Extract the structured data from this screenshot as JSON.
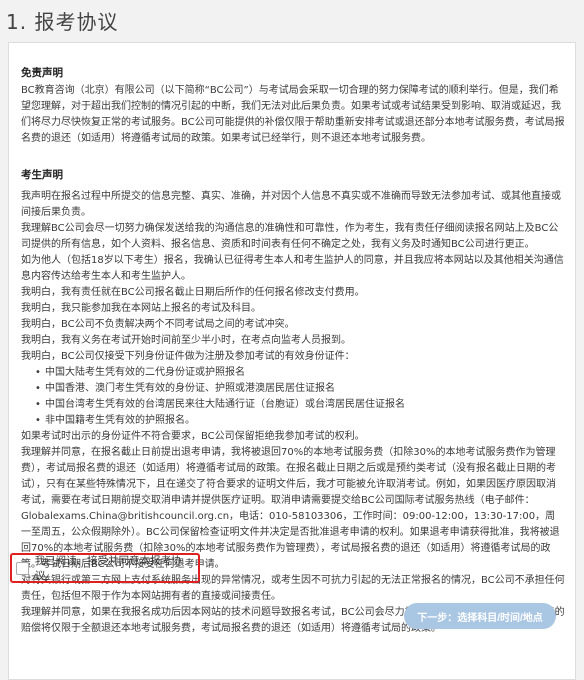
{
  "page": {
    "title": "1. 报考协议"
  },
  "disclaimer": {
    "title": "免责声明",
    "lines": [
      "BC教育咨询（北京）有限公司（以下简称“BC公司”）与考试局会采取一切合理的努力保障考试的顺利举行。但是，我们希望您理解，对于超出我们控制的情况引起的中断，我们无法对此后果负责。如果考试或考试结果受到影响、取消或延迟，我们将尽力尽快恢复正常的考试服务。BC公司可能提供的补偿仅限于帮助重新安排考试或退还部分本地考试服务费，考试局报名费的退还（如适用）将遵循考试局的政策。如果考试已经举行，则不退还本地考试服务费。"
    ]
  },
  "declaration": {
    "title": "考生声明",
    "lines": [
      "我声明在报名过程中所提交的信息完整、真实、准确，并对因个人信息不真实或不准确而导致无法参加考试、或其他直接或间接后果负责。",
      "我理解BC公司会尽一切努力确保发送给我的沟通信息的准确性和可靠性，作为考生，我有责任仔细阅读报名网站上及BC公司提供的所有信息，如个人资料、报名信息、资质和时间表有任何不确定之处，我有义务及时通知BC公司进行更正。",
      "如为他人（包括18岁以下考生）报名，我确认已征得考生本人和考生监护人的同意，并且我应将本网站以及其他相关沟通信息内容传达给考生本人和考生监护人。",
      "我明白，我有责任就在BC公司报名截止日期后所作的任何报名修改支付费用。",
      "我明白，我只能参加我在本网站上报名的考试及科目。",
      "我明白，BC公司不负责解决两个不同考试局之间的考试冲突。",
      "我明白，我有义务在考试开始时间前至少半小时，在考点向监考人员报到。",
      "我明白，BC公司仅接受下列身份证件做为注册及参加考试的有效身份证件："
    ],
    "bullets": [
      "中国大陆考生凭有效的二代身份证或护照报名",
      "中国香港、澳门考生凭有效的身份证、护照或港澳居民居住证报名",
      "中国台湾考生凭有效的台湾居民来往大陆通行证（台胞证）或台湾居民居住证报名",
      "非中国籍考生凭有效的护照报名。"
    ],
    "tail_lines": [
      "如果考试时出示的身份证件不符合要求，BC公司保留拒绝我参加考试的权利。",
      "我理解并同意，在报名截止日前提出退考申请，我将被退回70%的本地考试服务费（扣除30%的本地考试服务费作为管理费），考试局报名费的退还（如适用）将遵循考试局的政策。在报名截止日期之后或是预约类考试（没有报名截止日期的考试），只有在某些特殊情况下，且在递交了符合要求的证明文件后，我才可能被允许取消考试。例如，如果因医疗原因取消考试，需要在考试日期前提交取消申请并提供医疗证明。取消申请需要提交给BC公司国际考试服务热线（电子邮件：Globalexams.China@britishcouncil.org.cn，电话：010-58103306，工作时间：09:00-12:00，13:30-17:00，周一至周五，公众假期除外）。BC公司保留检查证明文件并决定是否批准退考申请的权利。如果退考申请获得批准，我将被退回70%的本地考试服务费（扣除30%的本地考试服务费作为管理费），考试局报名费的退还（如适用）将遵循考试局的政策。考试日期后BC公司不接受任何退考申请。",
      "对有关银行或第三方网上支付系统服务出现的异常情况，或考生因不可抗力引起的无法正常报名的情况，BC公司不承担任何责任，包括但不限于作为本网站拥有者的直接或间接责任。",
      "我理解并同意，如果在我报名成功后因本网站的技术问题导致报名考试，BC公司会尽力重新安排，如果我选择退赔，可能的赔偿将仅限于全额退还本地考试服务费，考试局报名费的退还（如适用）将遵循考试局的政策。"
    ]
  },
  "agreement": {
    "label": "我已阅读、接受并同意本报考协议。",
    "checked": false
  },
  "actions": {
    "next_label": "下一步：选择科目/时间/地点"
  },
  "colors": {
    "highlight_border": "#e02020",
    "next_button_bg": "#a9c6e3"
  }
}
